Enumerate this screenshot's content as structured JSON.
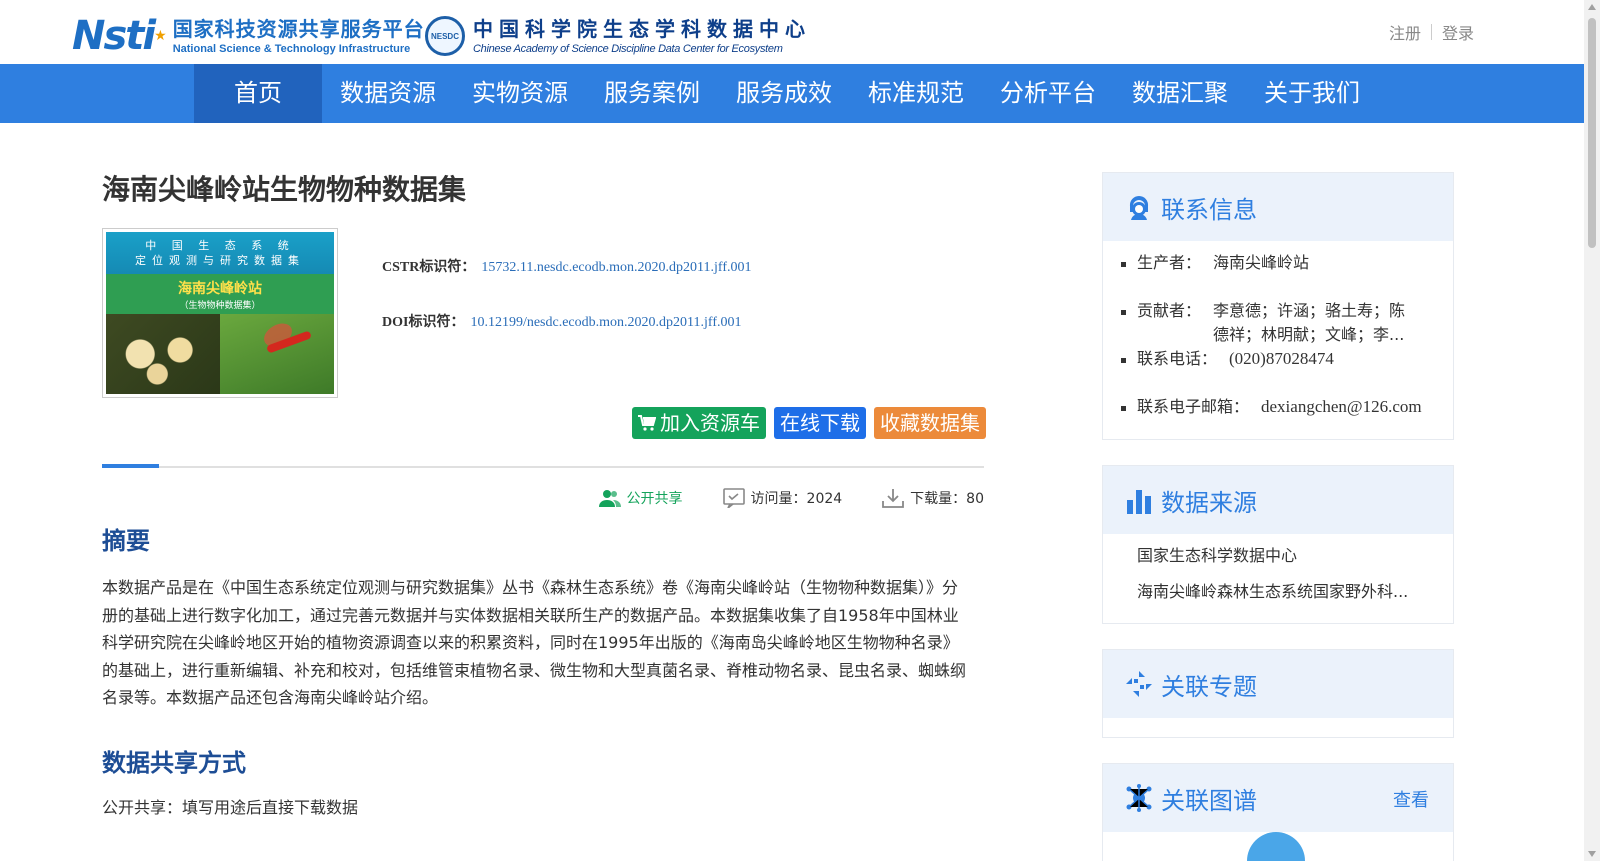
{
  "header": {
    "logo1": {
      "cn": "国家科技资源共享服务平台",
      "en": "National Science & Technology Infrastructure",
      "mark": "Nsti"
    },
    "logo2": {
      "badge": "NESDC",
      "cn": "中国科学院生态学科数据中心",
      "en": "Chinese Academy of Science Discipline Data Center for Ecosystem"
    },
    "auth": {
      "register": "注册",
      "login": "登录"
    }
  },
  "nav": {
    "items": [
      {
        "label": "首页",
        "active": true
      },
      {
        "label": "数据资源"
      },
      {
        "label": "实物资源"
      },
      {
        "label": "服务案例"
      },
      {
        "label": "服务成效"
      },
      {
        "label": "标准规范"
      },
      {
        "label": "分析平台"
      },
      {
        "label": "数据汇聚"
      },
      {
        "label": "关于我们"
      }
    ]
  },
  "dataset": {
    "title": "海南尖峰岭站生物物种数据集",
    "cover": {
      "line1": "中 国 生 态 系 统",
      "line2": "定位观测与研究数据集",
      "name": "海南尖峰岭站",
      "sub": "（生物物种数据集）"
    },
    "cstr_label": "CSTR标识符：",
    "cstr_value": "15732.11.nesdc.ecodb.mon.2020.dp2011.jff.001",
    "doi_label": "DOI标识符：",
    "doi_value": "10.12199/nesdc.ecodb.mon.2020.dp2011.jff.001",
    "buttons": {
      "cart": "加入资源车",
      "download": "在线下载",
      "favorite": "收藏数据集"
    },
    "stats": {
      "share": "公开共享",
      "visits": "访问量：2024",
      "downloads": "下载量：80"
    },
    "abstract_title": "摘要",
    "abstract": "本数据产品是在《中国生态系统定位观测与研究数据集》丛书《森林生态系统》卷《海南尖峰岭站（生物物种数据集）》分册的基础上进行数字化加工，通过完善元数据并与实体数据相关联所生产的数据产品。本数据集收集了自1958年中国林业科学研究院在尖峰岭地区开始的植物资源调查以来的积累资料，同时在1995年出版的《海南岛尖峰岭地区生物物种名录》的基础上，进行重新编辑、补充和校对，包括维管束植物名录、微生物和大型真菌名录、脊椎动物名录、昆虫名录、蜘蛛纲名录等。本数据产品还包含海南尖峰岭站介绍。",
    "share_title": "数据共享方式",
    "share_text": "公开共享：填写用途后直接下载数据"
  },
  "sidebar": {
    "contact": {
      "title": "联系信息",
      "producer_label": "生产者：",
      "producer": "海南尖峰岭站",
      "contributor_label": "贡献者：",
      "contributor_line1": "李意德；许涵；骆土寿；陈",
      "contributor_line2": "德祥；林明献；文峰；李...",
      "phone_label": "联系电话：",
      "phone": "(020)87028474",
      "email_label": "联系电子邮箱：",
      "email": "dexiangchen@126.com"
    },
    "source": {
      "title": "数据来源",
      "items": [
        "国家生态科学数据中心",
        "海南尖峰岭森林生态系统国家野外科..."
      ]
    },
    "topic": {
      "title": "关联专题"
    },
    "graph": {
      "title": "关联图谱",
      "more": "查看"
    }
  },
  "colors": {
    "nav_bg": "#2f7fe0",
    "nav_active": "#2163bd",
    "green": "#14a35b",
    "blue": "#1e6ee8",
    "orange": "#ec8a3a",
    "section_title": "#1d4d95"
  }
}
